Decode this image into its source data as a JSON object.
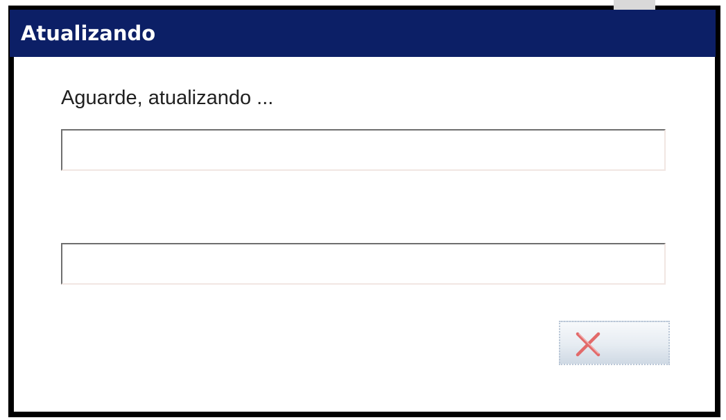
{
  "window": {
    "title": "Atualizando",
    "message": "Aguarde, atualizando ..."
  },
  "progress": {
    "primary": 0,
    "secondary": 0
  },
  "buttons": {
    "cancel": {
      "icon": "close-x-icon",
      "label": ""
    }
  },
  "colors": {
    "titlebar": "#0c1f66",
    "cancel_icon": "#e26a6a"
  }
}
